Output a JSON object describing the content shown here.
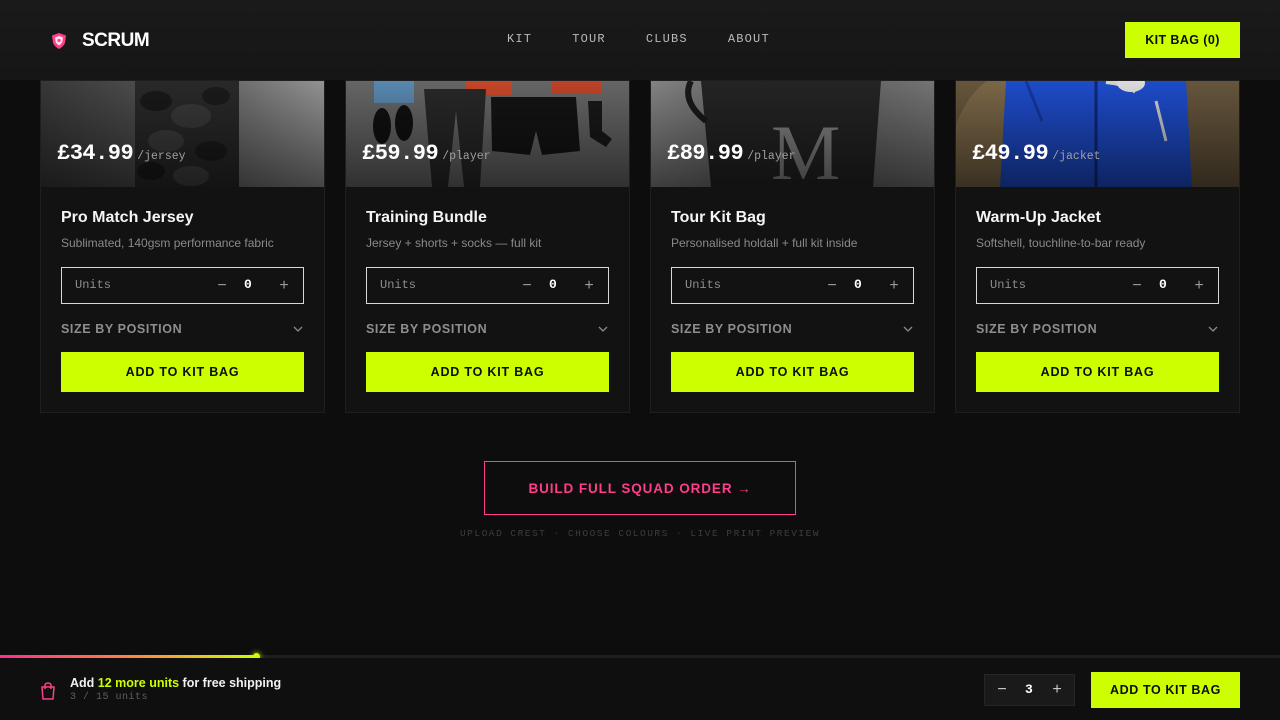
{
  "header": {
    "brand": "SCRUM",
    "nav": [
      "KIT",
      "TOUR",
      "CLUBS",
      "ABOUT"
    ],
    "kit_bag_label": "KIT BAG (0)"
  },
  "colors": {
    "accent": "#ccff00",
    "pink": "#ff3d8a",
    "background": "#0d0d0d"
  },
  "products": [
    {
      "price": "£34.99",
      "unit": "/jersey",
      "title": "Pro Match Jersey",
      "description": "Sublimated, 140gsm performance fabric",
      "units_label": "Units",
      "units_value": "0",
      "size_label": "SIZE BY POSITION",
      "add_label": "ADD TO KIT BAG"
    },
    {
      "price": "£59.99",
      "unit": "/player",
      "title": "Training Bundle",
      "description": "Jersey + shorts + socks — full kit",
      "units_label": "Units",
      "units_value": "0",
      "size_label": "SIZE BY POSITION",
      "add_label": "ADD TO KIT BAG"
    },
    {
      "price": "£89.99",
      "unit": "/player",
      "title": "Tour Kit Bag",
      "description": "Personalised holdall + full kit inside",
      "units_label": "Units",
      "units_value": "0",
      "size_label": "SIZE BY POSITION",
      "add_label": "ADD TO KIT BAG"
    },
    {
      "price": "£49.99",
      "unit": "/jacket",
      "title": "Warm-Up Jacket",
      "description": "Softshell, touchline-to-bar ready",
      "units_label": "Units",
      "units_value": "0",
      "size_label": "SIZE BY POSITION",
      "add_label": "ADD TO KIT BAG"
    }
  ],
  "squad": {
    "button_label": "BUILD FULL SQUAD ORDER →",
    "subtext": "UPLOAD CREST · CHOOSE COLOURS · LIVE PRINT PREVIEW"
  },
  "footer": {
    "ship_prefix": "Add ",
    "ship_highlight": "12 more units",
    "ship_suffix": " for free shipping",
    "ship_sub": "3 / 15 units",
    "progress_fraction": 0.2,
    "qty_value": "3",
    "add_label": "ADD TO KIT BAG"
  }
}
